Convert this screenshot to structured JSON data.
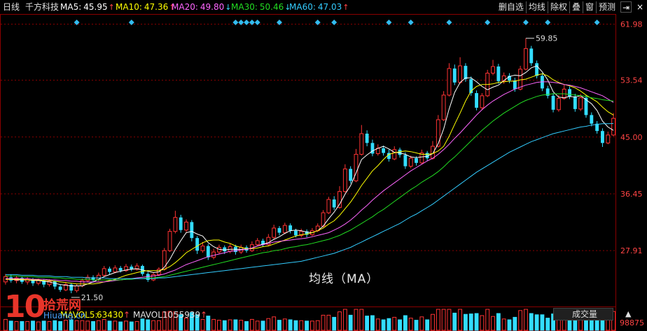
{
  "header": {
    "period": "日线",
    "stock": "千方科技",
    "ma": [
      {
        "label": "MA5:",
        "value": "45.95",
        "trend": "↑",
        "color": "#ffffff"
      },
      {
        "label": "MA10:",
        "value": "47.36",
        "trend": "↑",
        "color": "#ffff00"
      },
      {
        "label": "MA20:",
        "value": "49.80",
        "trend": "↓",
        "color": "#ff66ff"
      },
      {
        "label": "MA30:",
        "value": "50.46",
        "trend": "↓",
        "color": "#22dd22"
      },
      {
        "label": "MA60:",
        "value": "47.03",
        "trend": "↑",
        "color": "#33ccff"
      }
    ],
    "buttons": [
      "删自选",
      "均线",
      "除权",
      "叠",
      "窗",
      "预测"
    ],
    "pin_icon": "⇥",
    "close_icon": "×"
  },
  "price_axis": {
    "ticks": [
      "61.98",
      "53.54",
      "45.00",
      "36.45",
      "27.91"
    ]
  },
  "annotations": {
    "high": "59.85",
    "low": "21.50",
    "center_text": "均线（MA）"
  },
  "volume_header": {
    "mavol5_label": "MAVOL5:",
    "mavol5_value": "63430",
    "mavol10_label": "MAVOL10:",
    "mavol10_value": "55939",
    "trend": "↑",
    "vol_tick": "98875",
    "switch_label": "成交量",
    "switch_icon": "▲"
  },
  "colors": {
    "up": "#ff3333",
    "down": "#33ddff",
    "grid": "#8b0000",
    "axis_text": "#ff4444",
    "diamond": "#33bbee"
  },
  "logo": {
    "number": "10",
    "cn": "拾荒网",
    "domain": "Hiuang.cn"
  },
  "chart_data": {
    "type": "candlestick",
    "title": "",
    "ylim": [
      19.5,
      63.5
    ],
    "yticks": [
      61.98,
      53.54,
      45.0,
      36.45,
      27.91
    ],
    "high": 59.85,
    "low": 21.5,
    "candles": [
      [
        23.2,
        24.0,
        22.8,
        24.4
      ],
      [
        23.9,
        23.4,
        23.1,
        24.3
      ],
      [
        23.4,
        23.8,
        23.0,
        24.1
      ],
      [
        23.8,
        23.2,
        22.9,
        24.0
      ],
      [
        23.2,
        23.6,
        22.8,
        23.9
      ],
      [
        23.6,
        23.0,
        22.6,
        23.8
      ],
      [
        23.0,
        23.4,
        22.7,
        23.7
      ],
      [
        23.4,
        22.8,
        22.4,
        23.6
      ],
      [
        22.8,
        23.3,
        22.5,
        23.6
      ],
      [
        23.3,
        22.5,
        22.1,
        23.4
      ],
      [
        22.5,
        22.0,
        21.7,
        22.8
      ],
      [
        22.0,
        22.8,
        21.8,
        23.2
      ],
      [
        22.8,
        21.9,
        21.5,
        23.0
      ],
      [
        21.9,
        22.6,
        21.6,
        22.9
      ],
      [
        22.6,
        23.4,
        22.4,
        23.7
      ],
      [
        23.4,
        23.9,
        23.1,
        24.3
      ],
      [
        23.9,
        23.5,
        23.1,
        24.2
      ],
      [
        23.5,
        24.2,
        23.3,
        24.6
      ],
      [
        24.2,
        25.2,
        24.0,
        25.6
      ],
      [
        25.2,
        24.7,
        24.3,
        25.5
      ],
      [
        24.7,
        25.3,
        24.5,
        25.7
      ],
      [
        25.3,
        24.9,
        24.6,
        25.6
      ],
      [
        24.9,
        25.5,
        24.7,
        25.9
      ],
      [
        25.5,
        25.1,
        24.8,
        25.8
      ],
      [
        25.1,
        25.6,
        24.9,
        26.0
      ],
      [
        25.6,
        24.4,
        24.1,
        25.8
      ],
      [
        24.4,
        23.5,
        23.2,
        24.7
      ],
      [
        23.5,
        24.3,
        23.3,
        24.6
      ],
      [
        24.3,
        25.1,
        24.1,
        25.4
      ],
      [
        25.1,
        27.9,
        24.9,
        28.3
      ],
      [
        27.9,
        30.8,
        27.7,
        31.2
      ],
      [
        30.8,
        32.9,
        30.5,
        33.9
      ],
      [
        32.9,
        31.0,
        30.6,
        33.3
      ],
      [
        31.0,
        32.2,
        30.7,
        32.6
      ],
      [
        32.2,
        29.8,
        29.3,
        32.5
      ],
      [
        29.8,
        27.9,
        27.4,
        30.1
      ],
      [
        27.9,
        28.6,
        27.6,
        29.2
      ],
      [
        28.6,
        26.9,
        26.5,
        28.9
      ],
      [
        26.9,
        27.7,
        26.6,
        28.2
      ],
      [
        27.7,
        28.4,
        27.4,
        28.8
      ],
      [
        28.4,
        27.8,
        27.4,
        28.7
      ],
      [
        27.8,
        28.5,
        27.5,
        29.0
      ],
      [
        28.5,
        27.7,
        27.3,
        28.8
      ],
      [
        27.7,
        28.4,
        27.4,
        28.8
      ],
      [
        28.4,
        27.9,
        27.6,
        28.7
      ],
      [
        27.9,
        28.8,
        27.7,
        29.3
      ],
      [
        28.8,
        29.4,
        28.6,
        29.8
      ],
      [
        29.4,
        28.8,
        28.5,
        29.7
      ],
      [
        28.8,
        29.9,
        28.6,
        30.4
      ],
      [
        29.9,
        31.3,
        29.6,
        31.8
      ],
      [
        31.3,
        30.6,
        30.2,
        31.6
      ],
      [
        30.6,
        31.7,
        30.4,
        32.1
      ],
      [
        31.7,
        30.9,
        30.5,
        32.0
      ],
      [
        30.9,
        30.2,
        29.9,
        31.2
      ],
      [
        30.2,
        30.8,
        29.9,
        31.2
      ],
      [
        30.8,
        30.3,
        29.9,
        31.1
      ],
      [
        30.3,
        30.9,
        30.1,
        31.3
      ],
      [
        30.9,
        31.6,
        30.7,
        32.0
      ],
      [
        31.6,
        33.6,
        31.4,
        34.0
      ],
      [
        33.6,
        35.6,
        33.4,
        36.0
      ],
      [
        35.6,
        34.4,
        34.0,
        36.1
      ],
      [
        34.4,
        36.8,
        34.2,
        37.6
      ],
      [
        36.8,
        40.2,
        36.6,
        40.9
      ],
      [
        40.2,
        38.4,
        38.0,
        40.6
      ],
      [
        38.4,
        42.4,
        38.2,
        43.2
      ],
      [
        42.4,
        45.5,
        42.2,
        46.8
      ],
      [
        45.5,
        44.1,
        43.6,
        46.0
      ],
      [
        44.1,
        42.5,
        42.1,
        44.6
      ],
      [
        42.5,
        43.3,
        42.2,
        43.9
      ],
      [
        43.3,
        42.6,
        42.2,
        43.7
      ],
      [
        42.6,
        41.7,
        41.3,
        43.1
      ],
      [
        41.7,
        43.1,
        41.5,
        43.6
      ],
      [
        43.1,
        42.3,
        41.9,
        43.4
      ],
      [
        42.3,
        40.6,
        40.2,
        42.7
      ],
      [
        40.6,
        41.8,
        40.3,
        42.2
      ],
      [
        41.8,
        41.1,
        40.7,
        42.1
      ],
      [
        41.1,
        42.6,
        40.9,
        43.1
      ],
      [
        42.6,
        41.8,
        41.4,
        42.9
      ],
      [
        41.8,
        43.6,
        41.6,
        44.4
      ],
      [
        43.6,
        47.6,
        43.4,
        48.3
      ],
      [
        47.6,
        51.3,
        47.4,
        51.9
      ],
      [
        51.3,
        55.3,
        51.1,
        56.1
      ],
      [
        55.3,
        53.2,
        52.8,
        55.9
      ],
      [
        53.2,
        55.7,
        53.0,
        57.0
      ],
      [
        55.7,
        53.7,
        53.3,
        56.1
      ],
      [
        53.7,
        51.6,
        51.2,
        54.1
      ],
      [
        51.6,
        49.4,
        49.0,
        52.0
      ],
      [
        49.4,
        51.2,
        49.1,
        51.6
      ],
      [
        51.2,
        54.6,
        51.0,
        55.1
      ],
      [
        54.6,
        55.6,
        54.3,
        56.6
      ],
      [
        55.6,
        53.4,
        53.0,
        56.0
      ],
      [
        53.4,
        54.2,
        53.0,
        54.7
      ],
      [
        54.2,
        53.5,
        53.1,
        54.6
      ],
      [
        53.5,
        52.2,
        51.8,
        53.9
      ],
      [
        52.2,
        55.2,
        52.0,
        55.7
      ],
      [
        55.2,
        58.3,
        55.0,
        59.85
      ],
      [
        58.3,
        56.1,
        55.7,
        58.7
      ],
      [
        56.1,
        54.2,
        53.8,
        56.5
      ],
      [
        54.2,
        52.3,
        51.9,
        54.6
      ],
      [
        52.3,
        51.2,
        50.8,
        52.7
      ],
      [
        51.2,
        49.1,
        48.7,
        51.6
      ],
      [
        49.1,
        50.8,
        48.8,
        51.3
      ],
      [
        50.8,
        52.2,
        50.6,
        52.9
      ],
      [
        52.2,
        51.1,
        50.7,
        52.6
      ],
      [
        51.1,
        49.2,
        48.8,
        51.5
      ],
      [
        49.2,
        50.9,
        48.9,
        51.5
      ],
      [
        50.9,
        48.3,
        47.9,
        51.3
      ],
      [
        48.3,
        47.0,
        46.6,
        48.7
      ],
      [
        47.0,
        45.9,
        45.5,
        47.4
      ],
      [
        45.9,
        44.1,
        43.5,
        46.3
      ],
      [
        44.1,
        45.3,
        43.9,
        45.8
      ],
      [
        45.3,
        47.8,
        45.1,
        48.6
      ]
    ],
    "ma_series": [
      {
        "name": "MA5",
        "color": "#ffffff",
        "values": [
          23.6,
          23.6,
          23.5,
          23.5,
          23.5,
          23.4,
          23.4,
          23.3,
          23.2,
          23.0,
          22.8,
          22.7,
          22.6,
          22.6,
          22.6,
          22.9,
          23.2,
          23.6,
          24.0,
          24.3,
          24.6,
          24.8,
          25.0,
          25.1,
          25.2,
          25.0,
          24.8,
          24.6,
          24.7,
          25.4,
          26.6,
          28.1,
          29.4,
          30.6,
          30.8,
          30.4,
          30.1,
          29.1,
          28.5,
          28.1,
          28.0,
          28.1,
          28.1,
          28.1,
          28.1,
          28.3,
          28.6,
          28.9,
          29.1,
          29.6,
          30.0,
          30.5,
          30.9,
          31.0,
          30.9,
          30.7,
          30.6,
          30.9,
          31.6,
          32.7,
          33.7,
          34.9,
          36.4,
          37.7,
          39.6,
          41.6,
          42.3,
          42.9,
          43.3,
          43.6,
          43.2,
          42.7,
          42.6,
          42.4,
          42.0,
          41.9,
          42.0,
          42.1,
          42.5,
          44.0,
          46.2,
          49.2,
          51.7,
          53.2,
          53.9,
          53.9,
          53.3,
          52.6,
          52.1,
          52.5,
          52.8,
          53.5,
          54.1,
          54.3,
          54.2,
          54.7,
          55.4,
          55.7,
          54.8,
          53.6,
          51.8,
          51.0,
          50.9,
          51.1,
          51.0,
          51.2,
          50.6,
          50.0,
          49.0,
          47.4,
          46.5,
          46.0
        ]
      },
      {
        "name": "MA10",
        "color": "#ffff00",
        "values": [
          23.6,
          23.6,
          23.6,
          23.6,
          23.5,
          23.5,
          23.5,
          23.4,
          23.4,
          23.3,
          23.2,
          23.1,
          23.0,
          22.9,
          22.9,
          22.9,
          22.9,
          23.0,
          23.2,
          23.4,
          23.6,
          23.9,
          24.2,
          24.4,
          24.6,
          24.8,
          24.9,
          24.9,
          24.9,
          25.1,
          25.5,
          26.1,
          26.8,
          27.6,
          28.1,
          28.6,
          29.1,
          29.4,
          29.5,
          29.5,
          29.2,
          29.0,
          28.6,
          28.4,
          28.2,
          28.2,
          28.3,
          28.5,
          28.6,
          28.9,
          29.2,
          29.5,
          29.8,
          30.1,
          30.3,
          30.4,
          30.6,
          30.9,
          31.3,
          31.9,
          32.4,
          33.2,
          34.2,
          35.2,
          36.4,
          37.7,
          38.8,
          39.9,
          40.7,
          41.6,
          42.4,
          42.6,
          42.8,
          42.9,
          42.8,
          42.6,
          42.4,
          42.4,
          42.5,
          42.9,
          43.6,
          45.1,
          46.9,
          48.6,
          50.4,
          51.9,
          52.6,
          52.9,
          52.9,
          53.0,
          53.2,
          53.3,
          53.4,
          53.4,
          53.6,
          53.7,
          54.0,
          54.3,
          54.5,
          54.2,
          53.6,
          53.2,
          52.9,
          52.7,
          52.4,
          51.9,
          51.3,
          50.8,
          50.3,
          49.5,
          48.8,
          48.3
        ]
      },
      {
        "name": "MA20",
        "color": "#ff66ff",
        "values": [
          23.7,
          23.7,
          23.7,
          23.7,
          23.7,
          23.6,
          23.6,
          23.6,
          23.5,
          23.5,
          23.4,
          23.4,
          23.3,
          23.3,
          23.2,
          23.2,
          23.2,
          23.2,
          23.2,
          23.3,
          23.4,
          23.5,
          23.6,
          23.7,
          23.8,
          23.9,
          24.0,
          24.1,
          24.2,
          24.4,
          24.7,
          25.0,
          25.4,
          25.8,
          26.1,
          26.4,
          26.7,
          27.0,
          27.2,
          27.4,
          27.6,
          27.8,
          27.9,
          28.0,
          28.1,
          28.3,
          28.6,
          28.8,
          29.0,
          29.2,
          29.3,
          29.4,
          29.5,
          29.6,
          29.7,
          29.8,
          30.0,
          30.2,
          30.4,
          30.6,
          31.0,
          31.4,
          31.9,
          32.5,
          33.2,
          34.0,
          34.7,
          35.5,
          36.2,
          36.9,
          37.5,
          38.1,
          38.7,
          39.3,
          39.9,
          40.4,
          40.9,
          41.4,
          41.8,
          42.4,
          43.1,
          43.9,
          44.8,
          45.6,
          46.5,
          47.4,
          48.3,
          49.1,
          49.8,
          50.4,
          50.9,
          51.4,
          51.8,
          52.2,
          52.5,
          52.8,
          53.0,
          53.2,
          53.3,
          53.3,
          53.2,
          53.1,
          52.9,
          52.8,
          52.6,
          52.4,
          52.1,
          51.8,
          51.5,
          51.2,
          50.7,
          50.2
        ]
      },
      {
        "name": "MA30",
        "color": "#22dd22",
        "values": [
          24.1,
          24.1,
          24.1,
          24.0,
          24.0,
          24.0,
          23.9,
          23.9,
          23.9,
          23.8,
          23.8,
          23.7,
          23.7,
          23.6,
          23.6,
          23.6,
          23.5,
          23.5,
          23.5,
          23.5,
          23.5,
          23.5,
          23.6,
          23.6,
          23.7,
          23.7,
          23.8,
          23.8,
          23.9,
          24.0,
          24.2,
          24.4,
          24.6,
          24.8,
          25.0,
          25.2,
          25.4,
          25.6,
          25.8,
          26.0,
          26.2,
          26.4,
          26.6,
          26.8,
          27.0,
          27.2,
          27.4,
          27.6,
          27.7,
          27.9,
          28.0,
          28.2,
          28.4,
          28.5,
          28.7,
          28.8,
          29.0,
          29.2,
          29.4,
          29.6,
          29.9,
          30.2,
          30.6,
          31.0,
          31.5,
          32.0,
          32.5,
          33.0,
          33.6,
          34.1,
          34.7,
          35.3,
          35.9,
          36.5,
          37.1,
          37.6,
          38.2,
          38.7,
          39.2,
          39.8,
          40.5,
          41.3,
          42.0,
          42.8,
          43.6,
          44.4,
          45.2,
          46.0,
          46.7,
          47.4,
          48.0,
          48.6,
          49.1,
          49.6,
          50.1,
          50.5,
          50.8,
          51.1,
          51.3,
          51.4,
          51.5,
          51.5,
          51.5,
          51.4,
          51.3,
          51.2,
          51.1,
          50.9,
          50.8,
          50.6,
          50.5,
          50.4
        ]
      },
      {
        "name": "MA60",
        "color": "#33ccff",
        "values": [
          24.3,
          24.3,
          24.3,
          24.2,
          24.2,
          24.2,
          24.1,
          24.1,
          24.1,
          24.0,
          24.0,
          24.0,
          23.9,
          23.9,
          23.9,
          23.8,
          23.8,
          23.8,
          23.8,
          23.7,
          23.7,
          23.7,
          23.7,
          23.7,
          23.7,
          23.7,
          23.7,
          23.7,
          23.8,
          23.8,
          23.9,
          24.0,
          24.1,
          24.2,
          24.3,
          24.4,
          24.5,
          24.6,
          24.7,
          24.8,
          24.9,
          25.0,
          25.1,
          25.2,
          25.3,
          25.4,
          25.5,
          25.6,
          25.7,
          25.8,
          25.9,
          26.0,
          26.1,
          26.2,
          26.3,
          26.5,
          26.7,
          26.9,
          27.1,
          27.3,
          27.5,
          27.8,
          28.1,
          28.4,
          28.8,
          29.2,
          29.6,
          30.0,
          30.4,
          30.8,
          31.2,
          31.6,
          32.0,
          32.5,
          33.0,
          33.4,
          33.9,
          34.4,
          34.9,
          35.5,
          36.1,
          36.7,
          37.3,
          37.9,
          38.5,
          39.1,
          39.7,
          40.2,
          40.7,
          41.2,
          41.7,
          42.2,
          42.7,
          43.1,
          43.5,
          43.9,
          44.3,
          44.6,
          44.9,
          45.2,
          45.5,
          45.7,
          45.9,
          46.1,
          46.3,
          46.5,
          46.6,
          46.8,
          46.9,
          47.0,
          47.0,
          47.03
        ]
      }
    ],
    "diamond_markers": [
      13,
      23,
      42,
      43,
      44,
      45,
      46,
      50,
      57,
      60,
      70,
      74,
      81,
      88,
      95,
      99,
      108
    ]
  }
}
